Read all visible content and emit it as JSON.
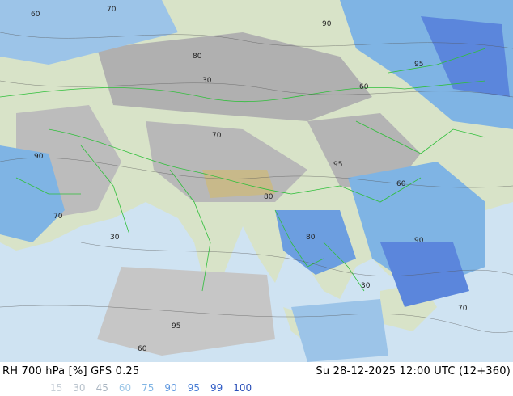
{
  "title": "RH 700 hPa [%] GFS 0.25",
  "valid_time": "Su 28-12-2025 12:00 UTC (12+360)",
  "legend": [
    {
      "value": "15",
      "color": "#c8d0d8"
    },
    {
      "value": "30",
      "color": "#b8c2cc"
    },
    {
      "value": "45",
      "color": "#a8b4c0"
    },
    {
      "value": "60",
      "color": "#9fc8e8"
    },
    {
      "value": "75",
      "color": "#7fb4e4"
    },
    {
      "value": "90",
      "color": "#5f98e0"
    },
    {
      "value": "95",
      "color": "#4a7fd6"
    },
    {
      "value": "99",
      "color": "#3460c8"
    },
    {
      "value": "100",
      "color": "#2a4fb8"
    }
  ],
  "colors": {
    "ocean": "#cfe3f2",
    "land": "#d8e3c8",
    "dry": "#b0b0b0",
    "moist": "#9cc4e8",
    "wet": "#5b86dc",
    "border": "#2fbf3a"
  },
  "contour_labels": [
    "60",
    "70",
    "80",
    "90",
    "95",
    "30",
    "60",
    "70",
    "80",
    "90",
    "95",
    "30",
    "60",
    "70",
    "80",
    "90",
    "95",
    "30",
    "60",
    "70"
  ]
}
